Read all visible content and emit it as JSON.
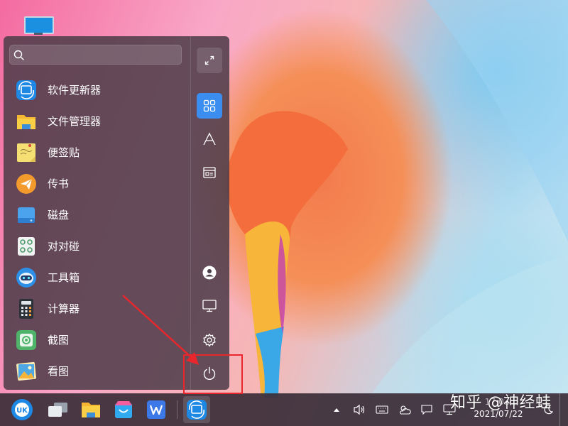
{
  "search": {
    "placeholder": "",
    "value": ""
  },
  "apps": [
    {
      "label": "软件更新器",
      "icon": "update-icon"
    },
    {
      "label": "文件管理器",
      "icon": "folder-icon"
    },
    {
      "label": "便签贴",
      "icon": "sticky-note-icon"
    },
    {
      "label": "传书",
      "icon": "paper-plane-icon"
    },
    {
      "label": "磁盘",
      "icon": "disk-icon"
    },
    {
      "label": "对对碰",
      "icon": "match-game-icon"
    },
    {
      "label": "工具箱",
      "icon": "toolbox-robot-icon"
    },
    {
      "label": "计算器",
      "icon": "calculator-icon"
    },
    {
      "label": "截图",
      "icon": "screenshot-icon"
    },
    {
      "label": "看图",
      "icon": "image-viewer-icon"
    }
  ],
  "sidebar": {
    "buttons": [
      "expand-icon",
      "all-apps-icon",
      "letter-sort-icon",
      "category-icon",
      "user-icon",
      "computer-icon",
      "settings-icon",
      "power-icon"
    ],
    "active": "all-apps-icon",
    "accent": "#3b8ef0"
  },
  "taskbar": {
    "apps": [
      "ukui-start-icon",
      "multitask-view-icon",
      "file-manager-icon",
      "software-store-icon",
      "wps-icon",
      "update-manager-icon"
    ],
    "tray": [
      "tray-up-arrow-icon",
      "volume-icon",
      "keyboard-icon",
      "weather-icon",
      "notification-icon",
      "network-icon"
    ],
    "clock_time": "17:0...",
    "clock_date": "2021/07/22"
  },
  "watermark": "知乎 @神经蛙",
  "annotation": {
    "color": "#e8262c"
  }
}
